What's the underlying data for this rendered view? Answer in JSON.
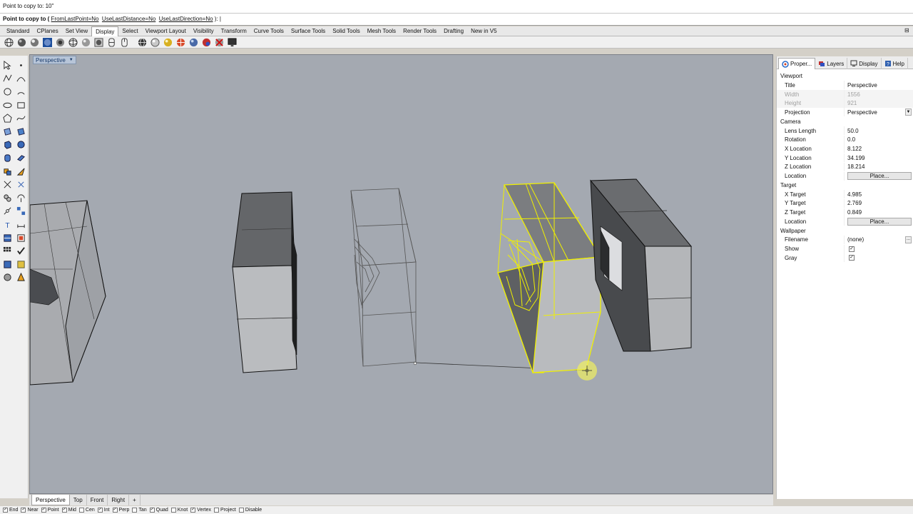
{
  "command": {
    "history": "Point to copy to: 10\"",
    "prompt_label": "Point to copy to",
    "options": [
      "FromLastPoint=No",
      "UseLastDistance=No",
      "UseLastDirection=No"
    ],
    "prompt_suffix": "):"
  },
  "toolbar_tabs": [
    "Standard",
    "CPlanes",
    "Set View",
    "Display",
    "Select",
    "Viewport Layout",
    "Visibility",
    "Transform",
    "Curve Tools",
    "Surface Tools",
    "Solid Tools",
    "Mesh Tools",
    "Render Tools",
    "Drafting",
    "New in V5"
  ],
  "active_toolbar_tab": "Display",
  "viewport": {
    "title": "Perspective",
    "tabs": [
      "Perspective",
      "Top",
      "Front",
      "Right"
    ],
    "add_tab": "+"
  },
  "osnaps": [
    {
      "label": "End",
      "checked": true
    },
    {
      "label": "Near",
      "checked": true
    },
    {
      "label": "Point",
      "checked": true
    },
    {
      "label": "Mid",
      "checked": true
    },
    {
      "label": "Cen",
      "checked": false
    },
    {
      "label": "Int",
      "checked": true
    },
    {
      "label": "Perp",
      "checked": true
    },
    {
      "label": "Tan",
      "checked": false
    },
    {
      "label": "Quad",
      "checked": true
    },
    {
      "label": "Knot",
      "checked": false
    },
    {
      "label": "Vertex",
      "checked": true
    },
    {
      "label": "Project",
      "checked": false
    },
    {
      "label": "Disable",
      "checked": false
    }
  ],
  "panel": {
    "tabs": [
      {
        "label": "Proper...",
        "icon": "properties-icon"
      },
      {
        "label": "Layers",
        "icon": "layers-icon"
      },
      {
        "label": "Display",
        "icon": "display-icon"
      },
      {
        "label": "Help",
        "icon": "help-icon"
      }
    ],
    "sections": {
      "viewport": "Viewport",
      "camera": "Camera",
      "target": "Target",
      "wallpaper": "Wallpaper"
    },
    "viewport_rows": {
      "title_label": "Title",
      "title_value": "Perspective",
      "width_label": "Width",
      "width_value": "1556",
      "height_label": "Height",
      "height_value": "921",
      "projection_label": "Projection",
      "projection_value": "Perspective"
    },
    "camera_rows": {
      "lens_label": "Lens Length",
      "lens_value": "50.0",
      "rotation_label": "Rotation",
      "rotation_value": "0.0",
      "x_label": "X Location",
      "x_value": "8.122",
      "y_label": "Y Location",
      "y_value": "34.199",
      "z_label": "Z Location",
      "z_value": "18.214",
      "location_label": "Location",
      "place_button": "Place..."
    },
    "target_rows": {
      "x_label": "X Target",
      "x_value": "4.985",
      "y_label": "Y Target",
      "y_value": "2.769",
      "z_label": "Z Target",
      "z_value": "0.849",
      "location_label": "Location",
      "place_button": "Place..."
    },
    "wallpaper_rows": {
      "filename_label": "Filename",
      "filename_value": "(none)",
      "browse_button": "...",
      "show_label": "Show",
      "show_checked": true,
      "gray_label": "Gray",
      "gray_checked": true
    }
  },
  "colors": {
    "viewport_bg": "#a4a9b1",
    "selection": "#f0f000",
    "dark_face": "#6b6d70",
    "light_face": "#b9bbbe"
  }
}
